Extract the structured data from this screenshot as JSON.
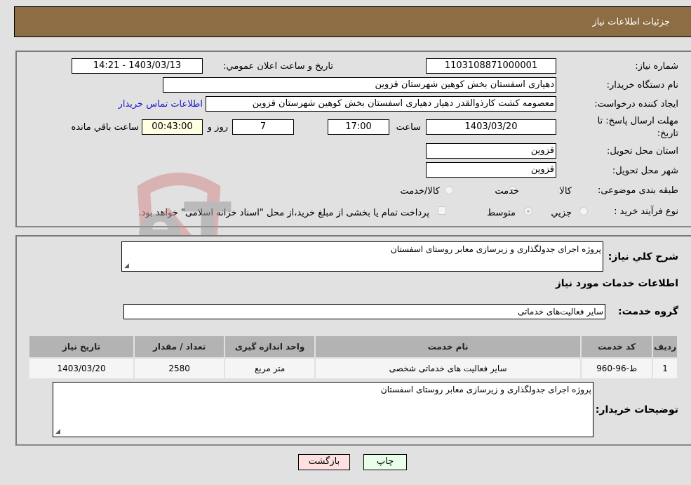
{
  "header": {
    "title": "جزئيات اطلاعات نياز"
  },
  "form": {
    "need_number": {
      "label": "شماره نياز:",
      "value": "1103108871000001"
    },
    "announce_datetime": {
      "label": "تاريخ و ساعت اعلان عمومي:",
      "value": "1403/03/13 - 14:21"
    },
    "buyer_org": {
      "label": "نام دستگاه خريدار:",
      "value": "دهیاری اسفستان بخش کوهین شهرستان قزوین"
    },
    "requester": {
      "label": "ايجاد كننده درخواست:",
      "value": "معصومه کشت کارذوالقدر دهیار دهیاری اسفستان بخش کوهین شهرستان قزوین",
      "contact_link": "اطلاعات تماس خريدار"
    },
    "deadline": {
      "label": "مهلت ارسال پاسخ: تا تاريخ:",
      "date": "1403/03/20",
      "time_label": "ساعت",
      "time": "17:00",
      "days": "7",
      "days_label": "روز و",
      "remaining": "00:43:00",
      "remaining_label": "ساعت باقي مانده"
    },
    "province": {
      "label": "استان محل تحويل:",
      "value": "قزوين"
    },
    "city": {
      "label": "شهر محل تحويل:",
      "value": "قزوين"
    },
    "category": {
      "label": "طبقه بندی موضوعی:",
      "options": [
        {
          "label": "کالا",
          "checked": false
        },
        {
          "label": "خدمت",
          "checked": true
        },
        {
          "label": "کالا/خدمت",
          "checked": false
        }
      ]
    },
    "purchase_type": {
      "label": "نوع فرآيند خريد :",
      "options": [
        {
          "label": "جزيي",
          "checked": false
        },
        {
          "label": "متوسط",
          "checked": true
        }
      ],
      "treasury_note": "پرداخت تمام يا بخشی از مبلغ خريد،از محل \"اسناد خزانه اسلامی\" خواهد بود."
    }
  },
  "details": {
    "description_label": "شرح کلي نياز:",
    "description": "پروژه اجرای جدولگذاری و زیرسازی معابر روستای اسفستان",
    "services_title": "اطلاعات خدمات مورد نياز",
    "service_group_label": "گروه خدمت:",
    "service_group": "ساير فعاليت‌هاى خدماتى",
    "table": {
      "headers": [
        "رديف",
        "کد خدمت",
        "نام خدمت",
        "واحد اندازه گيری",
        "تعداد / مقدار",
        "تاريخ نياز"
      ],
      "rows": [
        [
          "1",
          "ط-96-960",
          "ساير فعاليت هاى خدماتى شخصى",
          "متر مربع",
          "2580",
          "1403/03/20"
        ]
      ]
    },
    "buyer_notes_label": "توضيحات خريدار:",
    "buyer_notes": "پروژه اجرای جدولگذاری و زیرسازی معابر روستای اسفستان"
  },
  "buttons": {
    "print": "چاپ",
    "back": "بازگشت"
  },
  "watermark": {
    "text": "AriaTender.neT"
  }
}
